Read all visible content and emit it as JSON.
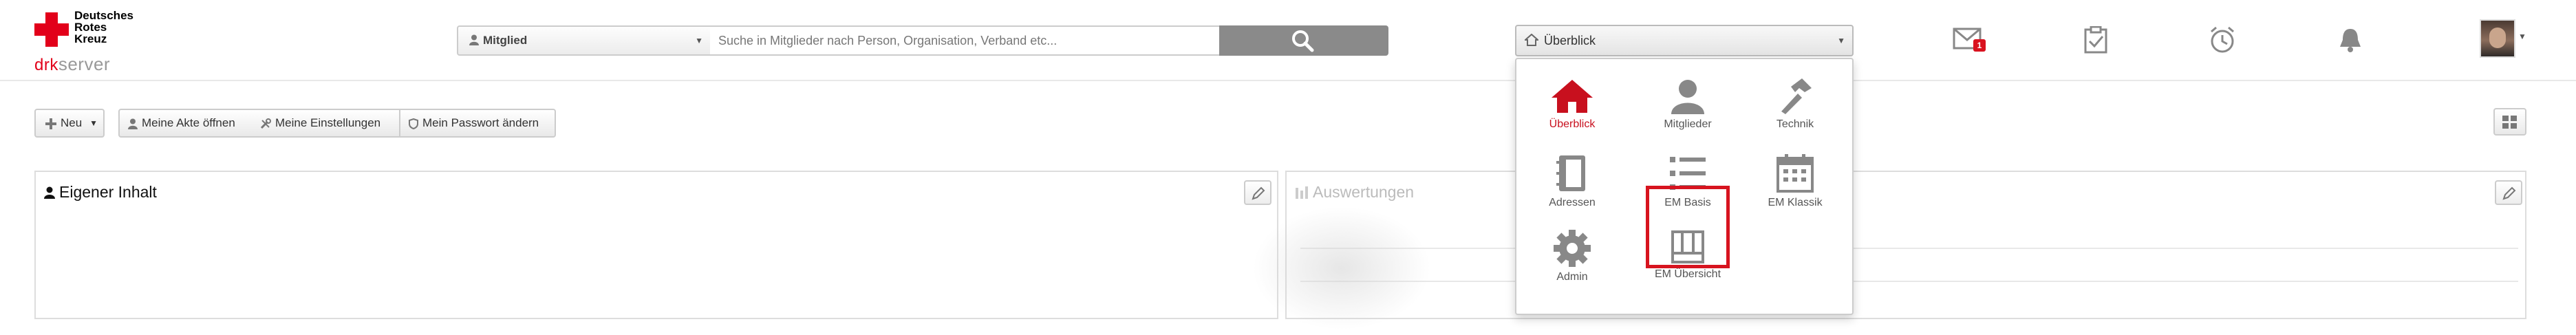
{
  "logo": {
    "line1": "Deutsches",
    "line2": "Rotes",
    "line3": "Kreuz",
    "server_prefix": "drk",
    "server_suffix": "server",
    "brand_color": "#e2001a"
  },
  "search": {
    "scope_value": "Mitglied",
    "placeholder": "Suche in Mitglieder nach Person, Organisation, Verband etc...",
    "button_icon": "search-icon"
  },
  "view_select": {
    "value": "Überblick",
    "icon": "home-icon"
  },
  "top_icons": [
    {
      "name": "mail-icon",
      "badge": "1"
    },
    {
      "name": "clipboard-check-icon"
    },
    {
      "name": "alarm-clock-icon"
    },
    {
      "name": "bell-icon"
    }
  ],
  "toolbar": {
    "new_label": "Neu",
    "akte_label": "Meine Akte öffnen",
    "settings_label": "Meine Einstellungen",
    "password_label": "Mein Passwort ändern"
  },
  "panels": {
    "left_title": "Eigener Inhalt",
    "right_title": "Auswertungen",
    "right_rows": [
      "",
      ""
    ]
  },
  "menu": {
    "items": [
      {
        "label": "Überblick",
        "icon": "home-icon",
        "active": true
      },
      {
        "label": "Mitglieder",
        "icon": "person-icon"
      },
      {
        "label": "Technik",
        "icon": "hammer-icon"
      },
      {
        "label": "Adressen",
        "icon": "address-book-icon"
      },
      {
        "label": "EM Basis",
        "icon": "list-icon",
        "highlighted": true
      },
      {
        "label": "EM Klassik",
        "icon": "calendar-icon"
      },
      {
        "label": "Admin",
        "icon": "gear-icon"
      },
      {
        "label": "EM Übersicht",
        "icon": "board-icon"
      }
    ],
    "active_color": "#c8101e",
    "highlight_color": "#d7141f"
  }
}
